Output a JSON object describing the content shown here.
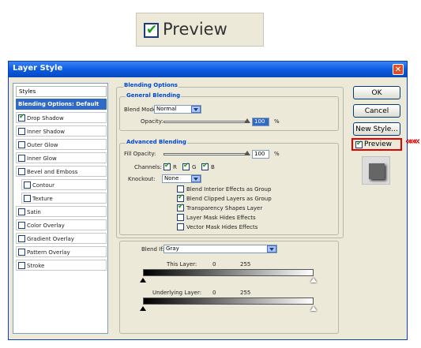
{
  "zoom_preview": {
    "label": "Preview",
    "checked": true
  },
  "dialog": {
    "title": "Layer Style",
    "close_glyph": "✕",
    "sidebar": {
      "header": "Styles",
      "items": [
        {
          "label": "Blending Options: Default",
          "selected": true,
          "has_checkbox": false
        },
        {
          "label": "Drop Shadow",
          "checked": true,
          "has_checkbox": true
        },
        {
          "label": "Inner Shadow",
          "checked": false,
          "has_checkbox": true
        },
        {
          "label": "Outer Glow",
          "checked": false,
          "has_checkbox": true
        },
        {
          "label": "Inner Glow",
          "checked": false,
          "has_checkbox": true
        },
        {
          "label": "Bevel and Emboss",
          "checked": false,
          "has_checkbox": true
        },
        {
          "label": "Contour",
          "checked": false,
          "has_checkbox": true,
          "indent": true
        },
        {
          "label": "Texture",
          "checked": false,
          "has_checkbox": true,
          "indent": true
        },
        {
          "label": "Satin",
          "checked": false,
          "has_checkbox": true
        },
        {
          "label": "Color Overlay",
          "checked": false,
          "has_checkbox": true
        },
        {
          "label": "Gradient Overlay",
          "checked": false,
          "has_checkbox": true
        },
        {
          "label": "Pattern Overlay",
          "checked": false,
          "has_checkbox": true
        },
        {
          "label": "Stroke",
          "checked": false,
          "has_checkbox": true
        }
      ]
    },
    "blending_options": {
      "title": "Blending Options",
      "general": {
        "title": "General Blending",
        "blend_mode_label": "Blend Mode:",
        "blend_mode_value": "Normal",
        "opacity_label": "Opacity:",
        "opacity_value": "100",
        "opacity_unit": "%",
        "opacity_fraction": 1.0
      },
      "advanced": {
        "title": "Advanced Blending",
        "fill_opacity_label": "Fill Opacity:",
        "fill_opacity_value": "100",
        "fill_opacity_unit": "%",
        "fill_opacity_fraction": 1.0,
        "channels_label": "Channels:",
        "channels": [
          {
            "label": "R",
            "checked": true
          },
          {
            "label": "G",
            "checked": true
          },
          {
            "label": "B",
            "checked": true
          }
        ],
        "knockout_label": "Knockout:",
        "knockout_value": "None",
        "options": [
          {
            "label": "Blend Interior Effects as Group",
            "checked": false
          },
          {
            "label": "Blend Clipped Layers as Group",
            "checked": true
          },
          {
            "label": "Transparency Shapes Layer",
            "checked": true
          },
          {
            "label": "Layer Mask Hides Effects",
            "checked": false
          },
          {
            "label": "Vector Mask Hides Effects",
            "checked": false
          }
        ]
      },
      "blend_if": {
        "label": "Blend If:",
        "value": "Gray",
        "this_layer_label": "This Layer:",
        "this_layer_low": "0",
        "this_layer_high": "255",
        "underlying_label": "Underlying Layer:",
        "underlying_low": "0",
        "underlying_high": "255"
      }
    },
    "buttons": {
      "ok": "OK",
      "cancel": "Cancel",
      "new_style": "New Style...",
      "preview": "Preview",
      "preview_checked": true
    },
    "callout_glyph": "«««"
  },
  "colors": {
    "title_bar": "#0a5ce0",
    "dialog_bg": "#ece9d8",
    "selected_item": "#316ac5",
    "highlight_box": "#e00000",
    "close_button": "#d9512c"
  }
}
